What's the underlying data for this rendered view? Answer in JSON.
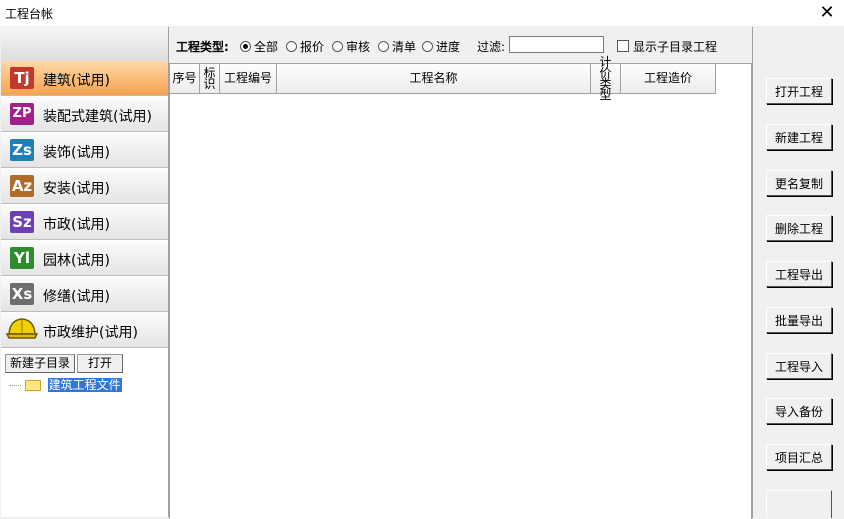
{
  "window": {
    "title": "工程台帐",
    "close_glyph": "✕"
  },
  "categories": [
    {
      "icon": "Tj",
      "label": "建筑(试用)",
      "color": "#c0392b",
      "active": true
    },
    {
      "icon": "ZP",
      "label": "装配式建筑(试用)",
      "color": "#a1208a"
    },
    {
      "icon": "Zs",
      "label": "装饰(试用)",
      "color": "#1f7fb8"
    },
    {
      "icon": "Az",
      "label": "安装(试用)",
      "color": "#b06a2a"
    },
    {
      "icon": "Sz",
      "label": "市政(试用)",
      "color": "#6c3fb5"
    },
    {
      "icon": "Yl",
      "label": "园林(试用)",
      "color": "#2e8b2e"
    },
    {
      "icon": "Xs",
      "label": "修缮(试用)",
      "color": "#6e6e6e"
    },
    {
      "icon": "helmet-icon",
      "label": "市政维护(试用)",
      "color": "#e8c200"
    }
  ],
  "tree": {
    "new_subdir_label": "新建子目录",
    "open_label": "打开",
    "nodes": [
      {
        "label": "建筑工程文件",
        "selected": true
      }
    ]
  },
  "filter": {
    "type_label": "工程类型:",
    "options": [
      "全部",
      "报价",
      "审核",
      "清单",
      "进度"
    ],
    "selected": "全部",
    "filter_label": "过滤:",
    "filter_value": "",
    "show_subdir_label": "显示子目录工程",
    "show_subdir_checked": false
  },
  "table": {
    "columns": [
      "序号",
      "标识",
      "工程编号",
      "工程名称",
      "计价类型",
      "工程造价"
    ],
    "rows": []
  },
  "actions": [
    "打开工程",
    "新建工程",
    "更名复制",
    "删除工程",
    "工程导出",
    "批量导出",
    "工程导入",
    "导入备份",
    "项目汇总"
  ]
}
